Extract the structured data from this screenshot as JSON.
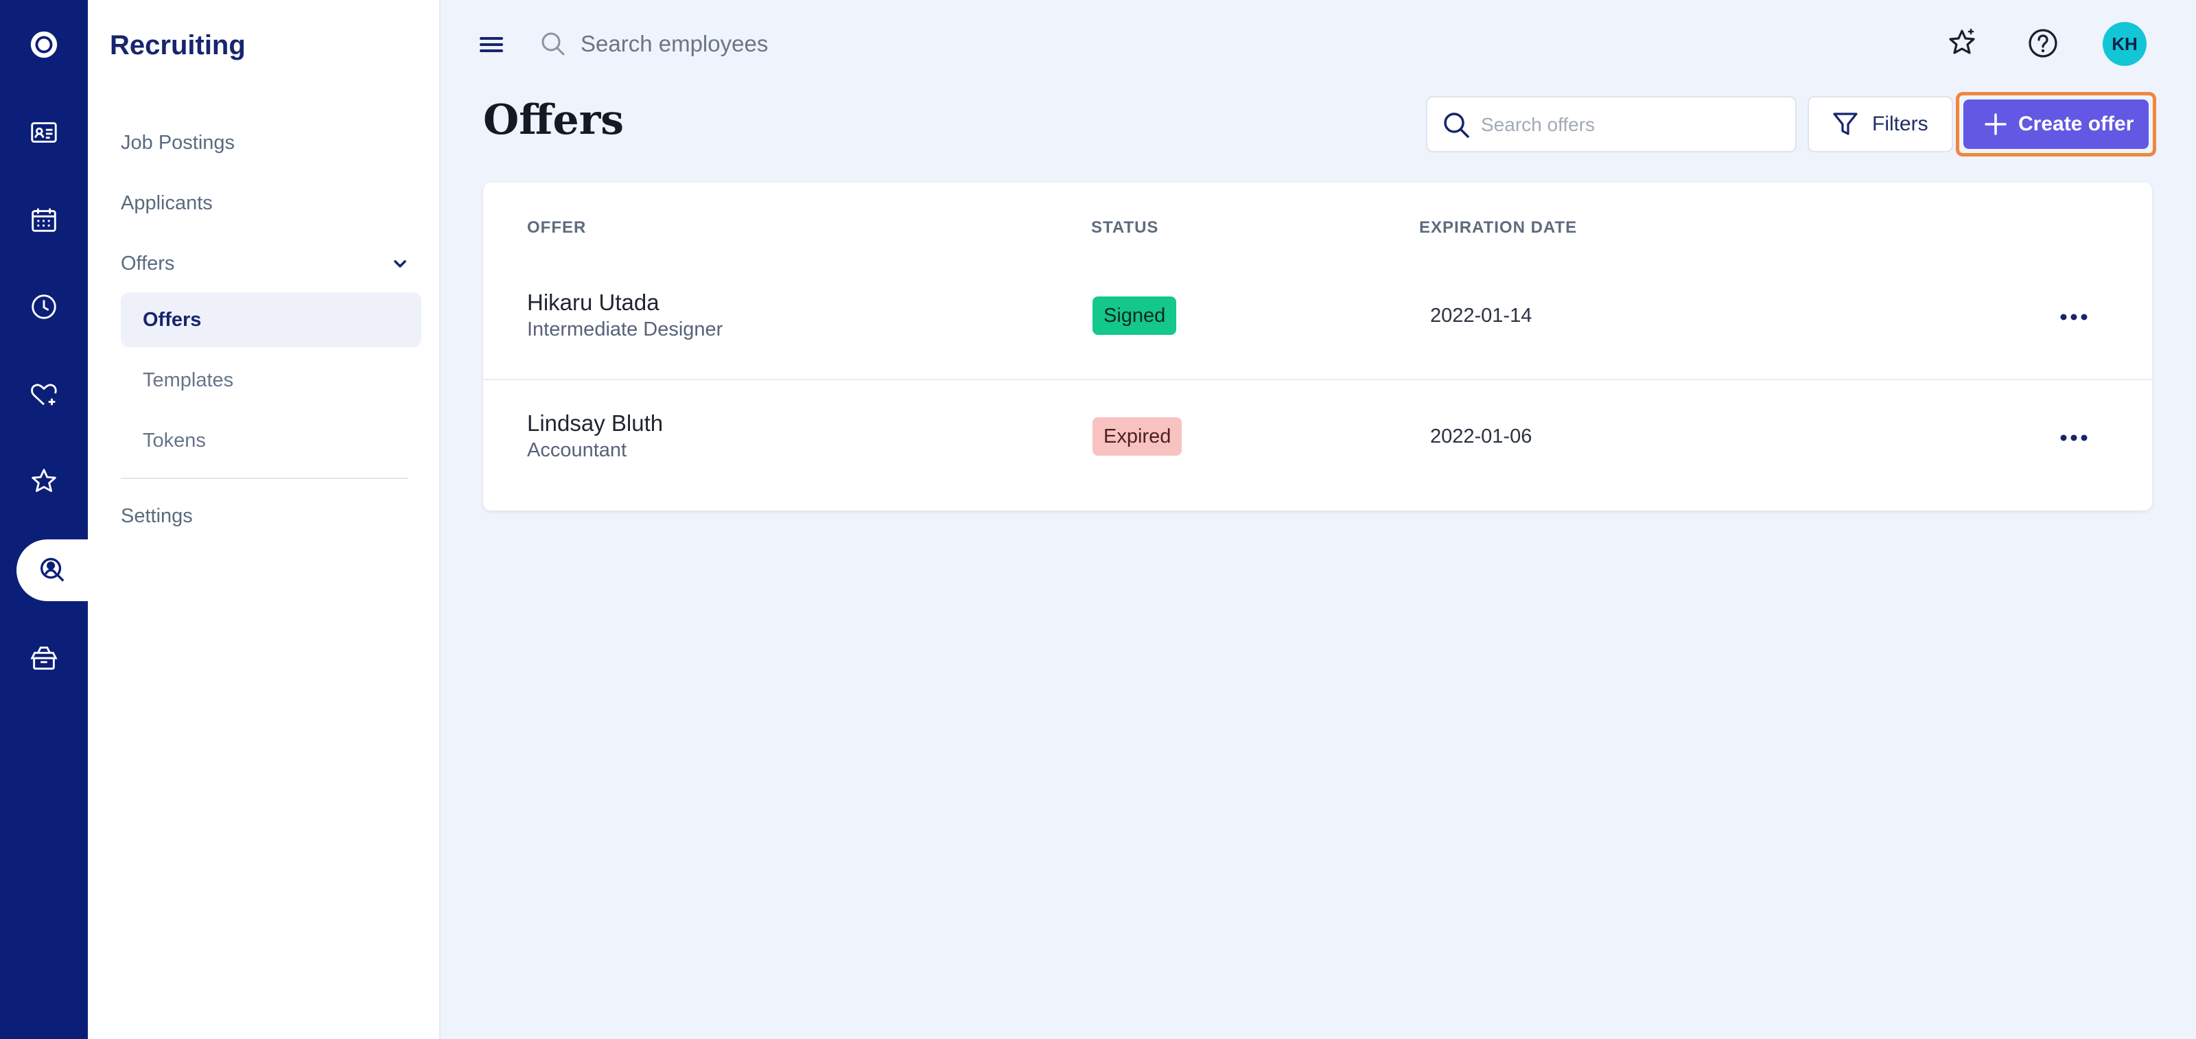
{
  "top_bar": {
    "search_placeholder": "Search employees",
    "avatar_initials": "KH"
  },
  "rail": {
    "items": [
      "logo-icon",
      "contact-card-icon",
      "calendar-icon",
      "clock-icon",
      "heart-plus-icon",
      "star-icon",
      "recruiting-search-icon",
      "gift-box-icon"
    ],
    "active": "recruiting-search-icon"
  },
  "sidebar": {
    "title": "Recruiting",
    "items": {
      "job_postings": "Job Postings",
      "applicants": "Applicants",
      "offers": "Offers",
      "settings": "Settings"
    },
    "offers_sub": {
      "offers": "Offers",
      "templates": "Templates",
      "tokens": "Tokens"
    }
  },
  "page": {
    "title": "Offers",
    "search_placeholder": "Search offers",
    "filters_label": "Filters",
    "create_label": "Create offer"
  },
  "table": {
    "headers": {
      "offer": "OFFER",
      "status": "STATUS",
      "expiration": "EXPIRATION DATE"
    },
    "rows": [
      {
        "name": "Hikaru Utada",
        "role": "Intermediate Designer",
        "status": "Signed",
        "date": "2022-01-14"
      },
      {
        "name": "Lindsay Bluth",
        "role": "Accountant",
        "status": "Expired",
        "date": "2022-01-06"
      }
    ]
  },
  "colors": {
    "rail": "#0b1f78",
    "accent": "#6358e3",
    "highlight_outline": "#f0873c",
    "signed": "#14c78a",
    "expired": "#f8c2c0",
    "avatar": "#12c6d6"
  }
}
